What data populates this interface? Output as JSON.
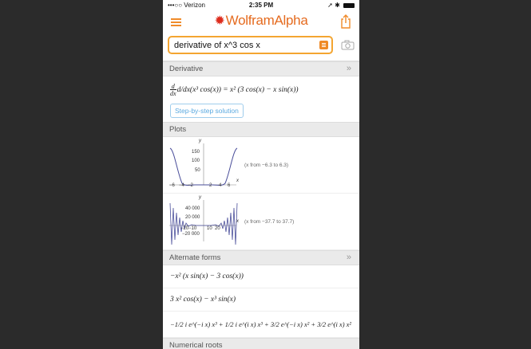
{
  "status": {
    "carrier": "•••○○ Verizon",
    "time": "2:35 PM"
  },
  "app": {
    "logo_text": "WolframAlpha"
  },
  "search": {
    "query": "derivative of x^3 cos x"
  },
  "pods": {
    "derivative": {
      "title": "Derivative",
      "result": "d/dx(x³ cos(x)) = x² (3 cos(x) − x sin(x))",
      "step_button": "Step-by-step solution"
    },
    "plots": {
      "title": "Plots",
      "plot1": {
        "note": "(x from −6.3 to 6.3)",
        "ylabel": "y",
        "xlabel": "x",
        "yticks": [
          "150",
          "100",
          "50"
        ],
        "xticks": [
          "−6",
          "−4",
          "−2",
          "2",
          "4",
          "6"
        ]
      },
      "plot2": {
        "note": "(x from −37.7 to 37.7)",
        "ylabel": "y",
        "xlabel": "x",
        "yticks": [
          "40 000",
          "20 000"
        ],
        "xticks": [
          "−20",
          "−10",
          "10",
          "20"
        ],
        "ytick_neg": "−20 000"
      }
    },
    "alternate": {
      "title": "Alternate forms",
      "form1": "−x² (x sin(x) − 3 cos(x))",
      "form2": "3 x² cos(x) − x³ sin(x)",
      "form3": "−1/2 i e^(−i x) x³ + 1/2 i e^(i x) x³ + 3/2 e^(−i x) x² + 3/2 e^(i x) x²"
    },
    "numerical": {
      "title": "Numerical roots"
    }
  }
}
